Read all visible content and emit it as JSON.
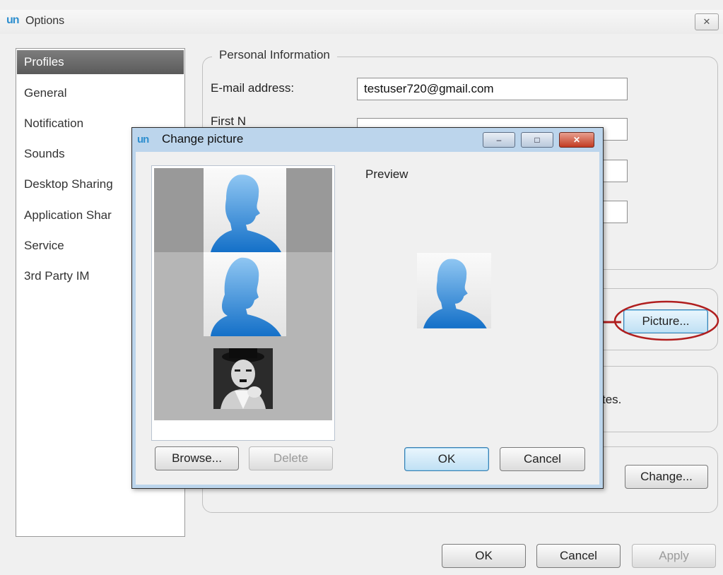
{
  "window": {
    "title": "Options",
    "logo_text": "un",
    "close_label": "✕"
  },
  "nav": {
    "items": [
      {
        "label": "Profiles",
        "selected": true
      },
      {
        "label": "General"
      },
      {
        "label": "Notification"
      },
      {
        "label": "Sounds"
      },
      {
        "label": "Desktop Sharing"
      },
      {
        "label": "Application  Shar"
      },
      {
        "label": "Service"
      },
      {
        "label": "3rd Party IM"
      }
    ]
  },
  "personal_info": {
    "legend": "Personal Information",
    "email_label": "E-mail address:",
    "email_value": "testuser720@gmail.com",
    "first_name_label": "First N"
  },
  "picture_group": {
    "picture_button": "Picture..."
  },
  "status_group": {
    "partial_text": "tes."
  },
  "lower_group": {
    "change_button": "Change..."
  },
  "footer": {
    "ok": "OK",
    "cancel": "Cancel",
    "apply": "Apply"
  },
  "dialog": {
    "title": "Change picture",
    "logo_text": "un",
    "minimize": "–",
    "maximize": "□",
    "close": "✕",
    "preview_label": "Preview",
    "pictures": [
      {
        "kind": "male-silhouette",
        "selected": true
      },
      {
        "kind": "female-silhouette"
      },
      {
        "kind": "photo"
      }
    ],
    "browse_button": "Browse...",
    "delete_button": "Delete",
    "ok_button": "OK",
    "cancel_button": "Cancel"
  },
  "annotation": {
    "arrow_color": "#b01e1e",
    "highlight_color": "#b01e1e"
  },
  "colors": {
    "accent": "#1a7fd6",
    "selected_nav": "#6a6a6a"
  }
}
